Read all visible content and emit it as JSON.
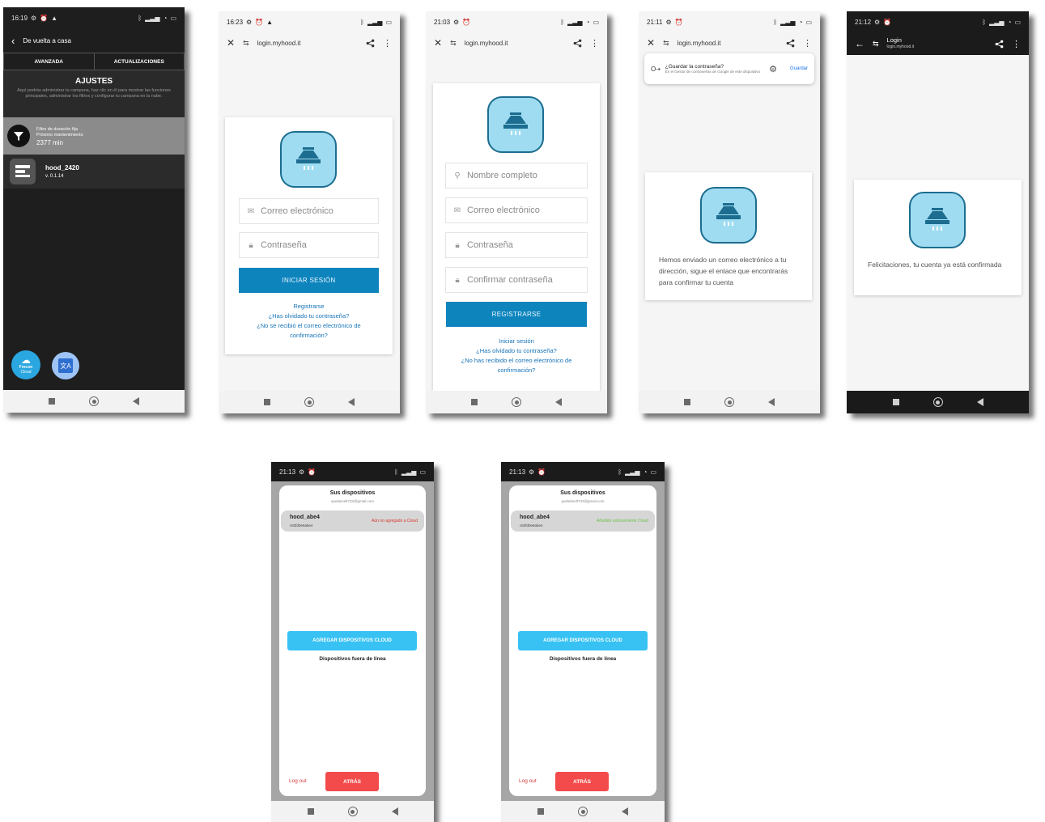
{
  "colors": {
    "primary": "#0e84bd",
    "cloud_button": "#37c2f3",
    "danger": "#f34b4b",
    "logo_bg": "#9fdcf2",
    "dark_bg": "#1e1e1e"
  },
  "s1": {
    "time": "16:19",
    "header_title": "De vuelta a casa",
    "tab_advanced": "AVANZADA",
    "tab_updates": "ACTUALIZACIONES",
    "section_title": "AJUSTES",
    "section_desc": "Aquí podrás administrar tu campana, haz clic en él para mostrar las funciones principales, administrar los filtros y configurar tu campana en la nube.",
    "filter_line1": "Filtro de duración fija",
    "filter_line2": "Próximo mantenimiento",
    "filter_value": "2377 min",
    "device_name": "hood_2420",
    "device_version": "v. 0.1.14",
    "cloud_label_1": "Frecon",
    "cloud_label_2": "Cloud",
    "translate_icon": "translate-icon"
  },
  "s2": {
    "time": "16:23",
    "url": "login.myhood.it",
    "email_placeholder": "Correo electrónico",
    "password_placeholder": "Contraseña",
    "login_button": "INICIAR SESIÓN",
    "link_register": "Registrarse",
    "link_forgot": "¿Has olvidado tu contraseña?",
    "link_no_email": "¿No se recibió el correo electrónico de confirmación?"
  },
  "s3": {
    "time": "21:03",
    "url": "login.myhood.it",
    "name_placeholder": "Nombre completo",
    "email_placeholder": "Correo electrónico",
    "password_placeholder": "Contraseña",
    "confirm_placeholder": "Confirmar contraseña",
    "register_button": "REGISTRARSE",
    "link_login": "Iniciar sesión",
    "link_forgot": "¿Has olvidado tu contraseña?",
    "link_no_email": "¿No has recibido el correo electrónico de confirmación?"
  },
  "s4": {
    "time": "21:11",
    "url": "login.myhood.it",
    "popup_title": "¿Guardar la contraseña?",
    "popup_sub": "En el Gestor de contraseñas de Google de este dispositivo",
    "popup_save": "Guardar",
    "message": "Hemos enviado un correo electrónico a tu dirección, sigue el enlace que encontrarás para confirmar tu cuenta"
  },
  "s5": {
    "time": "21:12",
    "title": "Login",
    "url": "login.myhood.it",
    "message": "Felicitaciones, tu cuenta ya está confirmada"
  },
  "s6": {
    "time": "21:13",
    "modal_title": "Sus dispositivos",
    "email": "quelaimelt733@gmail.com",
    "device_name": "hood_abe4",
    "device_id": "c83fd0e6abe4",
    "status": "Aún no agregado a Cloud",
    "status_color": "#d9342b",
    "cloud_button": "AGREGAR DISPOSITIVOS CLOUD",
    "offline_title": "Dispositivos fuera de línea",
    "logout": "Log out",
    "back": "ATRÁS"
  },
  "s7": {
    "time": "21:13",
    "modal_title": "Sus dispositivos",
    "email": "quelaimelt733@gmail.com",
    "device_name": "hood_abe4",
    "device_id": "c83fd0e6abe4",
    "status": "Añadido exitosamente Cloud",
    "status_color": "#6cc24a",
    "cloud_button": "AGREGAR DISPOSITIVOS CLOUD",
    "offline_title": "Dispositivos fuera de línea",
    "logout": "Log out",
    "back": "ATRÁS"
  }
}
